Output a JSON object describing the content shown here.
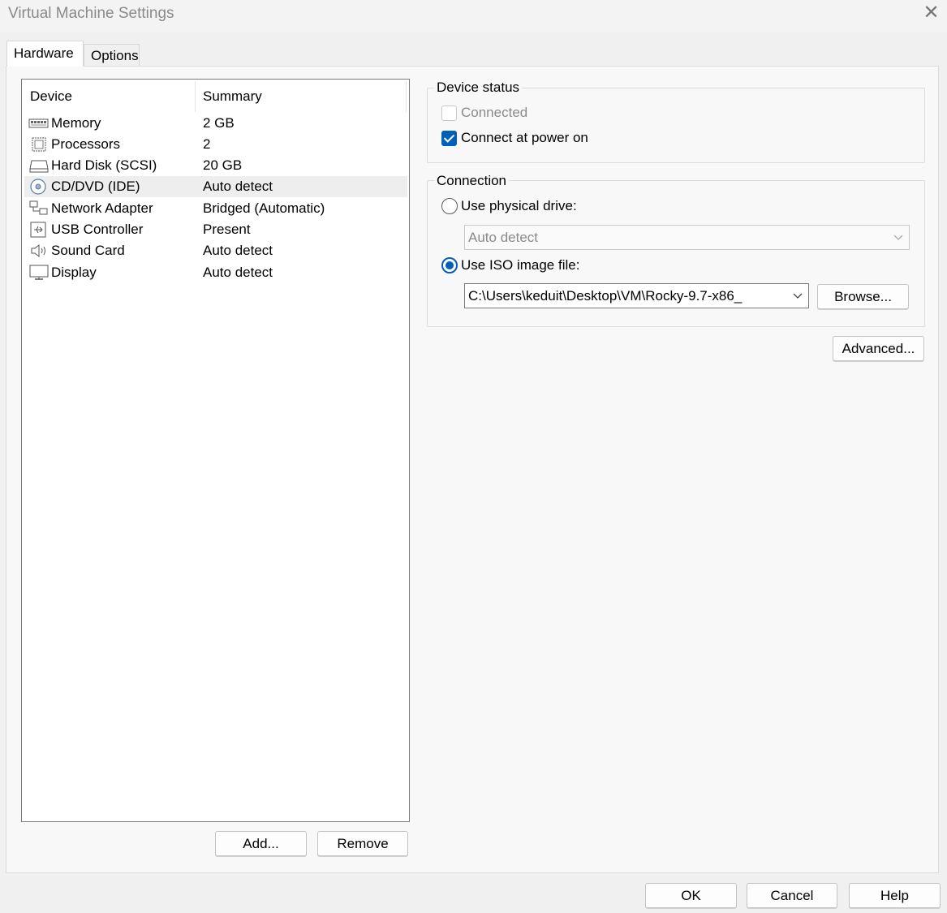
{
  "window": {
    "title": "Virtual Machine Settings",
    "close_glyph": "✕"
  },
  "tabs": [
    {
      "label": "Hardware"
    },
    {
      "label": "Options"
    }
  ],
  "device_list": {
    "columns": {
      "device": "Device",
      "summary": "Summary"
    },
    "rows": [
      {
        "icon": "memory-icon",
        "name": "Memory",
        "summary": "2 GB"
      },
      {
        "icon": "processor-icon",
        "name": "Processors",
        "summary": "2"
      },
      {
        "icon": "hard-disk-icon",
        "name": "Hard Disk (SCSI)",
        "summary": "20 GB"
      },
      {
        "icon": "cd-dvd-icon",
        "name": "CD/DVD (IDE)",
        "summary": "Auto detect",
        "selected": true
      },
      {
        "icon": "network-adapter-icon",
        "name": "Network Adapter",
        "summary": "Bridged (Automatic)"
      },
      {
        "icon": "usb-controller-icon",
        "name": "USB Controller",
        "summary": "Present"
      },
      {
        "icon": "sound-card-icon",
        "name": "Sound Card",
        "summary": "Auto detect"
      },
      {
        "icon": "display-icon",
        "name": "Display",
        "summary": "Auto detect"
      }
    ]
  },
  "list_buttons": {
    "add": "Add...",
    "remove": "Remove"
  },
  "device_status": {
    "title": "Device status",
    "connected": {
      "label": "Connected",
      "checked": false,
      "enabled": false
    },
    "connect_at_power_on": {
      "label": "Connect at power on",
      "checked": true,
      "enabled": true
    }
  },
  "connection": {
    "title": "Connection",
    "physical_drive": {
      "label": "Use physical drive:",
      "selected": false,
      "value": "Auto detect"
    },
    "iso_image": {
      "label": "Use ISO image file:",
      "selected": true,
      "value": "C:\\Users\\keduit\\Desktop\\VM\\Rocky-9.7-x86_"
    },
    "browse": "Browse..."
  },
  "advanced": "Advanced...",
  "footer": {
    "ok": "OK",
    "cancel": "Cancel",
    "help": "Help"
  },
  "colors": {
    "accent": "#005fb8",
    "disabled_text": "#8a8a8a"
  }
}
